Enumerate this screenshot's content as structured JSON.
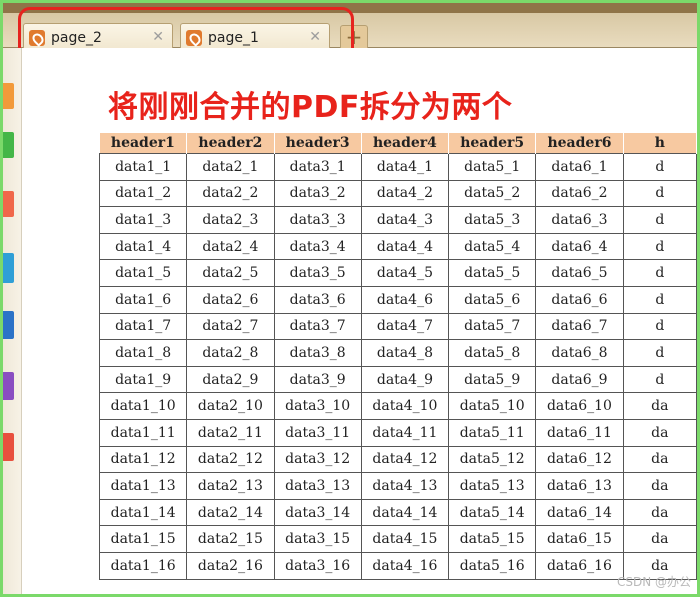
{
  "tabs": [
    {
      "label": "page_2"
    },
    {
      "label": "page_1"
    }
  ],
  "new_tab": "+",
  "caption": "将刚刚合并的PDF拆分为两个",
  "table": {
    "headers": [
      "header1",
      "header2",
      "header3",
      "header4",
      "header5",
      "header6",
      "h"
    ],
    "rows": [
      [
        "data1_1",
        "data2_1",
        "data3_1",
        "data4_1",
        "data5_1",
        "data6_1",
        "d"
      ],
      [
        "data1_2",
        "data2_2",
        "data3_2",
        "data4_2",
        "data5_2",
        "data6_2",
        "d"
      ],
      [
        "data1_3",
        "data2_3",
        "data3_3",
        "data4_3",
        "data5_3",
        "data6_3",
        "d"
      ],
      [
        "data1_4",
        "data2_4",
        "data3_4",
        "data4_4",
        "data5_4",
        "data6_4",
        "d"
      ],
      [
        "data1_5",
        "data2_5",
        "data3_5",
        "data4_5",
        "data5_5",
        "data6_5",
        "d"
      ],
      [
        "data1_6",
        "data2_6",
        "data3_6",
        "data4_6",
        "data5_6",
        "data6_6",
        "d"
      ],
      [
        "data1_7",
        "data2_7",
        "data3_7",
        "data4_7",
        "data5_7",
        "data6_7",
        "d"
      ],
      [
        "data1_8",
        "data2_8",
        "data3_8",
        "data4_8",
        "data5_8",
        "data6_8",
        "d"
      ],
      [
        "data1_9",
        "data2_9",
        "data3_9",
        "data4_9",
        "data5_9",
        "data6_9",
        "d"
      ],
      [
        "data1_10",
        "data2_10",
        "data3_10",
        "data4_10",
        "data5_10",
        "data6_10",
        "da"
      ],
      [
        "data1_11",
        "data2_11",
        "data3_11",
        "data4_11",
        "data5_11",
        "data6_11",
        "da"
      ],
      [
        "data1_12",
        "data2_12",
        "data3_12",
        "data4_12",
        "data5_12",
        "data6_12",
        "da"
      ],
      [
        "data1_13",
        "data2_13",
        "data3_13",
        "data4_13",
        "data5_13",
        "data6_13",
        "da"
      ],
      [
        "data1_14",
        "data2_14",
        "data3_14",
        "data4_14",
        "data5_14",
        "data6_14",
        "da"
      ],
      [
        "data1_15",
        "data2_15",
        "data3_15",
        "data4_15",
        "data5_15",
        "data6_15",
        "da"
      ],
      [
        "data1_16",
        "data2_16",
        "data3_16",
        "data4_16",
        "data5_16",
        "data6_16",
        "da"
      ]
    ]
  },
  "watermark": "CSDN @办公"
}
